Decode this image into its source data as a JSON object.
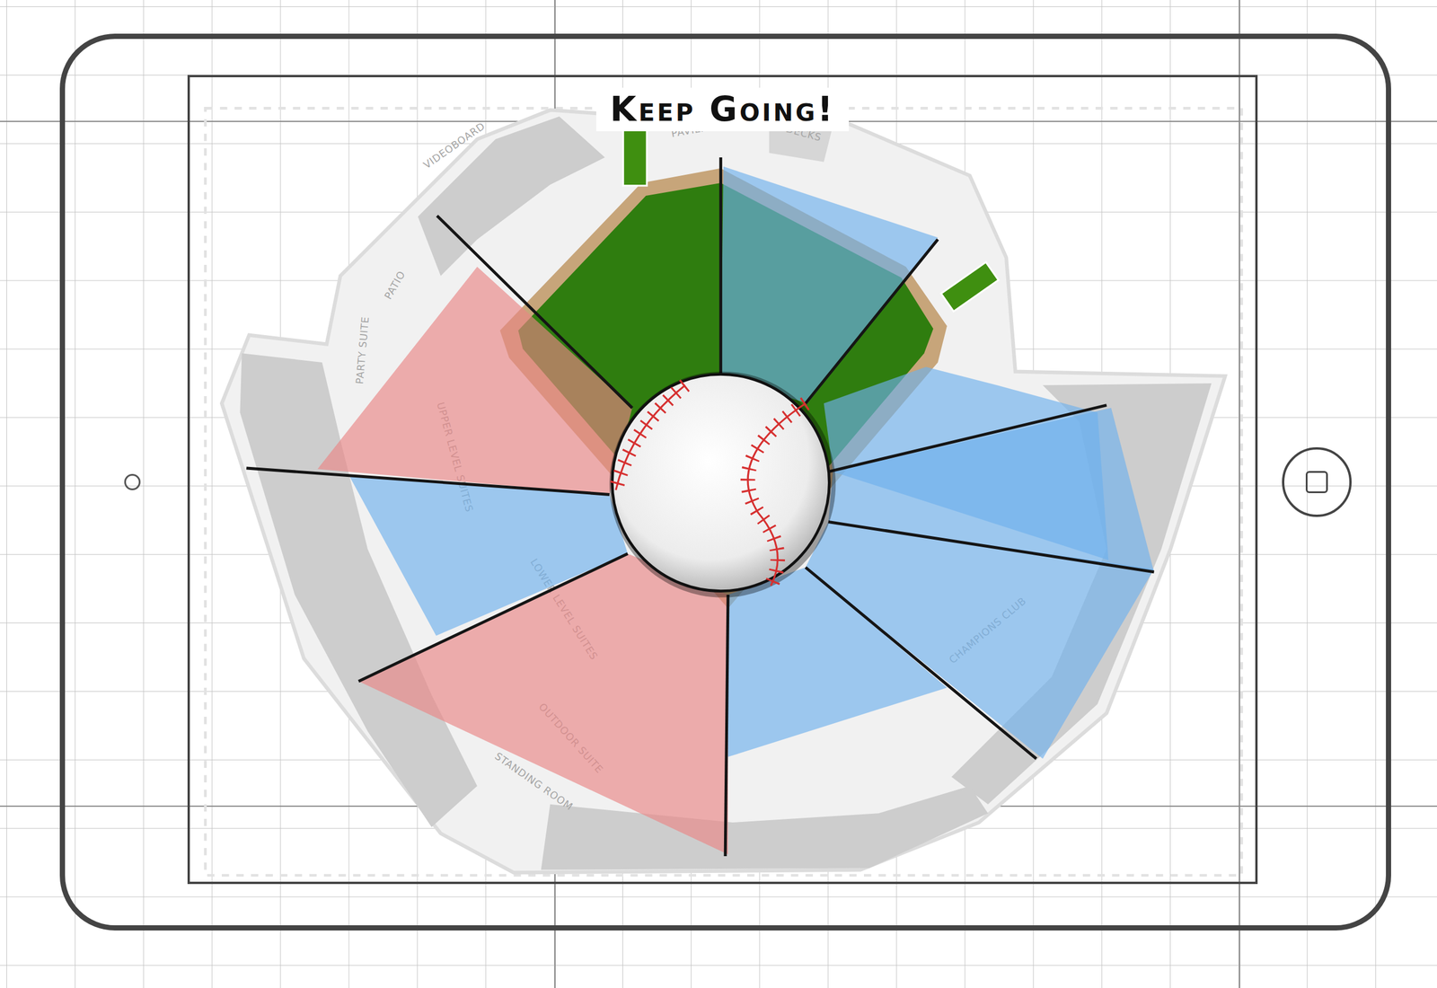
{
  "screen": {
    "title": "Keep Going!"
  },
  "map": {
    "labels": [
      "VIDEOBOARD",
      "PAVILION",
      "DECKS",
      "PATIO",
      "PARTY SUITE",
      "UPPER LEVEL SUITES",
      "LOWER LEVEL SUITES",
      "CHAMPIONS CLUB",
      "OUTDOOR SUITE",
      "STANDING ROOM"
    ],
    "wedges": [
      {
        "color": "#6fb0ec"
      },
      {
        "color": "#6fb0ec"
      },
      {
        "color": "#6fb0ec"
      },
      {
        "color": "#6fb0ec"
      },
      {
        "color": "#6fb0ec"
      },
      {
        "color": "#e98585"
      },
      {
        "color": "#6fb0ec"
      },
      {
        "color": "#e98585"
      }
    ]
  }
}
